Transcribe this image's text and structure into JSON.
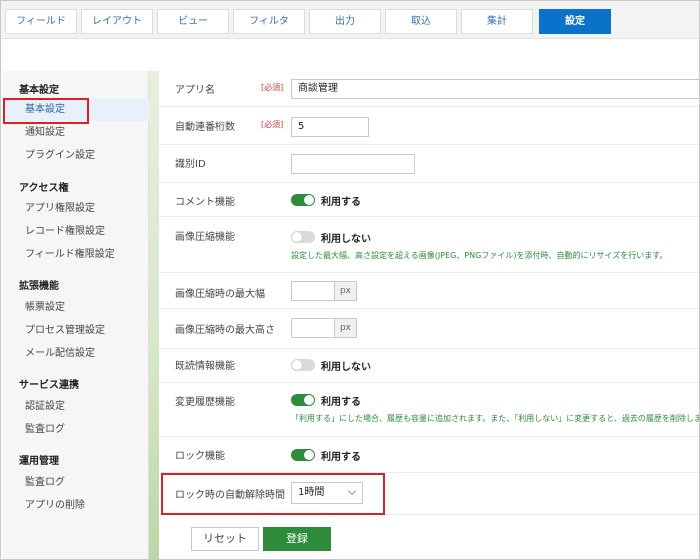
{
  "tabs": [
    "フィールド",
    "レイアウト",
    "ビュー",
    "フィルタ",
    "出力",
    "取込",
    "集計",
    "設定"
  ],
  "active_tab": "設定",
  "sidebar": {
    "groups": [
      {
        "title": "基本設定",
        "items": [
          "基本設定",
          "通知設定",
          "プラグイン設定"
        ]
      },
      {
        "title": "アクセス権",
        "items": [
          "アプリ権限設定",
          "レコード権限設定",
          "フィールド権限設定"
        ]
      },
      {
        "title": "拡張機能",
        "items": [
          "帳票設定",
          "プロセス管理設定",
          "メール配信設定"
        ]
      },
      {
        "title": "サービス連携",
        "items": [
          "認証設定",
          "監査ログ"
        ]
      },
      {
        "title": "運用管理",
        "items": [
          "監査ログ",
          "アプリの削除"
        ]
      }
    ]
  },
  "form": {
    "required_tag": "[必須]",
    "app_name": {
      "label": "アプリ名",
      "value": "商談管理"
    },
    "auto_number": {
      "label": "自動連番桁数",
      "value": "5"
    },
    "identifier": {
      "label": "識別ID",
      "value": ""
    },
    "comment": {
      "label": "コメント機能",
      "state": "利用する"
    },
    "image_compress": {
      "label": "画像圧縮機能",
      "state": "利用しない",
      "help": "設定した最大幅、高さ設定を超える画像(JPEG、PNGファイル)を添付時、自動的にリサイズを行います。"
    },
    "max_width": {
      "label": "画像圧縮時の最大幅",
      "unit": "px"
    },
    "max_height": {
      "label": "画像圧縮時の最大高さ",
      "unit": "px"
    },
    "read_info": {
      "label": "既読情報機能",
      "state": "利用しない"
    },
    "history": {
      "label": "変更履歴機能",
      "state": "利用する",
      "help": "「利用する」にした場合、履歴も容量に追加されます。また、「利用しない」に変更すると、過去の履歴を削除します。"
    },
    "lock": {
      "label": "ロック機能",
      "state": "利用する"
    },
    "lock_release": {
      "label": "ロック時の自動解除時間",
      "value": "1時間"
    }
  },
  "buttons": {
    "reset": "リセット",
    "save": "登録"
  },
  "colors": {
    "accent_blue": "#0a72c9",
    "toggle_on": "#2e8b3a",
    "highlight": "#e01f25"
  }
}
